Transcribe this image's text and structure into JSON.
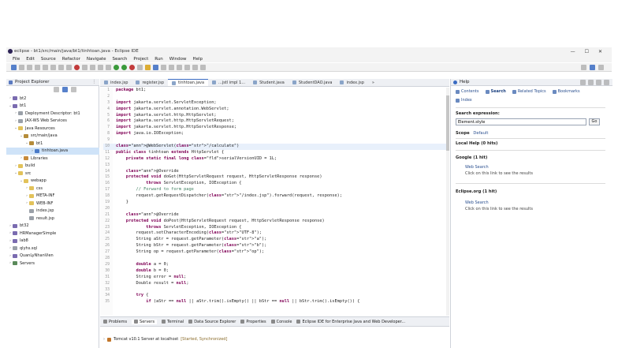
{
  "window": {
    "title": "eclipse - bt1/src/main/java/bt1/tinhtoan.java - Eclipse IDE",
    "controls": [
      "—",
      "☐",
      "✕"
    ]
  },
  "menu": [
    "File",
    "Edit",
    "Source",
    "Refactor",
    "Navigate",
    "Search",
    "Project",
    "Run",
    "Window",
    "Help"
  ],
  "explorer": {
    "title": "Project Explorer",
    "items": [
      {
        "label": "bt2",
        "depth": 0,
        "arrow": ">",
        "icon": "project"
      },
      {
        "label": "bt1",
        "depth": 0,
        "arrow": "v",
        "icon": "project"
      },
      {
        "label": "Deployment Descriptor: bt1",
        "depth": 1,
        "arrow": ">",
        "icon": "file"
      },
      {
        "label": "JAX-WS Web Services",
        "depth": 1,
        "arrow": ">",
        "icon": "file"
      },
      {
        "label": "Java Resources",
        "depth": 1,
        "arrow": "v",
        "icon": "folder"
      },
      {
        "label": "src/main/java",
        "depth": 2,
        "arrow": "v",
        "icon": "pkg"
      },
      {
        "label": "bt1",
        "depth": 3,
        "arrow": "v",
        "icon": "pkg"
      },
      {
        "label": "tinhtoan.java",
        "depth": 4,
        "arrow": ">",
        "icon": "java",
        "selected": true
      },
      {
        "label": "Libraries",
        "depth": 2,
        "arrow": ">",
        "icon": "lib"
      },
      {
        "label": "build",
        "depth": 1,
        "arrow": ">",
        "icon": "folder"
      },
      {
        "label": "src",
        "depth": 1,
        "arrow": "v",
        "icon": "folder"
      },
      {
        "label": "webapp",
        "depth": 2,
        "arrow": "v",
        "icon": "folder"
      },
      {
        "label": "css",
        "depth": 3,
        "arrow": ">",
        "icon": "folder"
      },
      {
        "label": "META-INF",
        "depth": 3,
        "arrow": ">",
        "icon": "folder"
      },
      {
        "label": "WEB-INF",
        "depth": 3,
        "arrow": ">",
        "icon": "folder"
      },
      {
        "label": "index.jsp",
        "depth": 3,
        "arrow": "",
        "icon": "file"
      },
      {
        "label": "result.jsp",
        "depth": 3,
        "arrow": "",
        "icon": "file"
      },
      {
        "label": "bt32",
        "depth": 0,
        "arrow": ">",
        "icon": "project"
      },
      {
        "label": "HRManagerSimple",
        "depth": 0,
        "arrow": ">",
        "icon": "project"
      },
      {
        "label": "lab8",
        "depth": 0,
        "arrow": ">",
        "icon": "project"
      },
      {
        "label": "qlyhs.sql",
        "depth": 0,
        "arrow": ">",
        "icon": "file"
      },
      {
        "label": "QuanLyNhanVien",
        "depth": 0,
        "arrow": ">",
        "icon": "project"
      },
      {
        "label": "Servers",
        "depth": 0,
        "arrow": ">",
        "icon": "server"
      }
    ]
  },
  "editor": {
    "tabs": [
      "index.jsp",
      "register.jsp",
      "tinhtoan.java",
      "...jstl impl 1...",
      "Student.java",
      "StudentDAO.java",
      "index.jsp",
      "»"
    ],
    "active_tab": 2,
    "lines": [
      {
        "n": "1",
        "t": "package bt1;"
      },
      {
        "n": "2",
        "t": ""
      },
      {
        "n": "3",
        "t": "import jakarta.servlet.ServletException;"
      },
      {
        "n": "4",
        "t": "import jakarta.servlet.annotation.WebServlet;"
      },
      {
        "n": "5",
        "t": "import jakarta.servlet.http.HttpServlet;"
      },
      {
        "n": "6",
        "t": "import jakarta.servlet.http.HttpServletRequest;"
      },
      {
        "n": "7",
        "t": "import jakarta.servlet.http.HttpServletResponse;"
      },
      {
        "n": "8",
        "t": "import java.io.IOException;"
      },
      {
        "n": "9",
        "t": ""
      },
      {
        "n": "10",
        "t": "@WebServlet(\"/calculate\")",
        "hl": true
      },
      {
        "n": "11",
        "t": "public class tinhtoan extends HttpServlet {"
      },
      {
        "n": "12",
        "t": "    private static final long serialVersionUID = 1L;"
      },
      {
        "n": "13",
        "t": ""
      },
      {
        "n": "14",
        "t": "    @Override"
      },
      {
        "n": "15",
        "t": "    protected void doGet(HttpServletRequest request, HttpServletResponse response)"
      },
      {
        "n": "16",
        "t": "            throws ServletException, IOException {"
      },
      {
        "n": "17",
        "t": "        // Forward to form page"
      },
      {
        "n": "18",
        "t": "        request.getRequestDispatcher(\"/index.jsp\").forward(request, response);"
      },
      {
        "n": "19",
        "t": "    }"
      },
      {
        "n": "20",
        "t": ""
      },
      {
        "n": "21",
        "t": "    @Override"
      },
      {
        "n": "22",
        "t": "    protected void doPost(HttpServletRequest request, HttpServletResponse response)"
      },
      {
        "n": "23",
        "t": "            throws ServletException, IOException {"
      },
      {
        "n": "24",
        "t": "        request.setCharacterEncoding(\"UTF-8\");"
      },
      {
        "n": "25",
        "t": "        String aStr = request.getParameter(\"a\");"
      },
      {
        "n": "26",
        "t": "        String bStr = request.getParameter(\"b\");"
      },
      {
        "n": "27",
        "t": "        String op = request.getParameter(\"op\");"
      },
      {
        "n": "28",
        "t": ""
      },
      {
        "n": "29",
        "t": "        double a = 0;"
      },
      {
        "n": "30",
        "t": "        double b = 0;"
      },
      {
        "n": "31",
        "t": "        String error = null;"
      },
      {
        "n": "32",
        "t": "        Double result = null;"
      },
      {
        "n": "33",
        "t": ""
      },
      {
        "n": "34",
        "t": "        try {"
      },
      {
        "n": "35",
        "t": "            if (aStr == null || aStr.trim().isEmpty() || bStr == null || bStr.trim().isEmpty()) {"
      }
    ]
  },
  "bottom": {
    "tabs": [
      "Problems",
      "Servers",
      "Terminal",
      "Data Source Explorer",
      "Properties",
      "Console",
      "Eclipse IDE for Enterprise Java and Web Developer..."
    ],
    "active_tab": 1,
    "server": {
      "name": "Tomcat v10.1 Server at localhost",
      "status": "[Started, Synchronized]"
    }
  },
  "help": {
    "title": "Help",
    "nav": [
      "Contents",
      "Search",
      "Related Topics",
      "Bookmarks"
    ],
    "nav_active": 1,
    "index_label": "Index",
    "search_label": "Search expression:",
    "search_value": "Element.style",
    "go_label": "Go",
    "scope_label": "Scope",
    "scope_value": "Default",
    "local_help": "Local Help (0 hits)",
    "google": "Google (1 hit)",
    "google_link": "Web Search",
    "google_desc": "Click on this link to see the results",
    "eclipse": "Eclipse.org (1 hit)",
    "eclipse_link": "Web Search",
    "eclipse_desc": "Click on this link to see the results"
  }
}
